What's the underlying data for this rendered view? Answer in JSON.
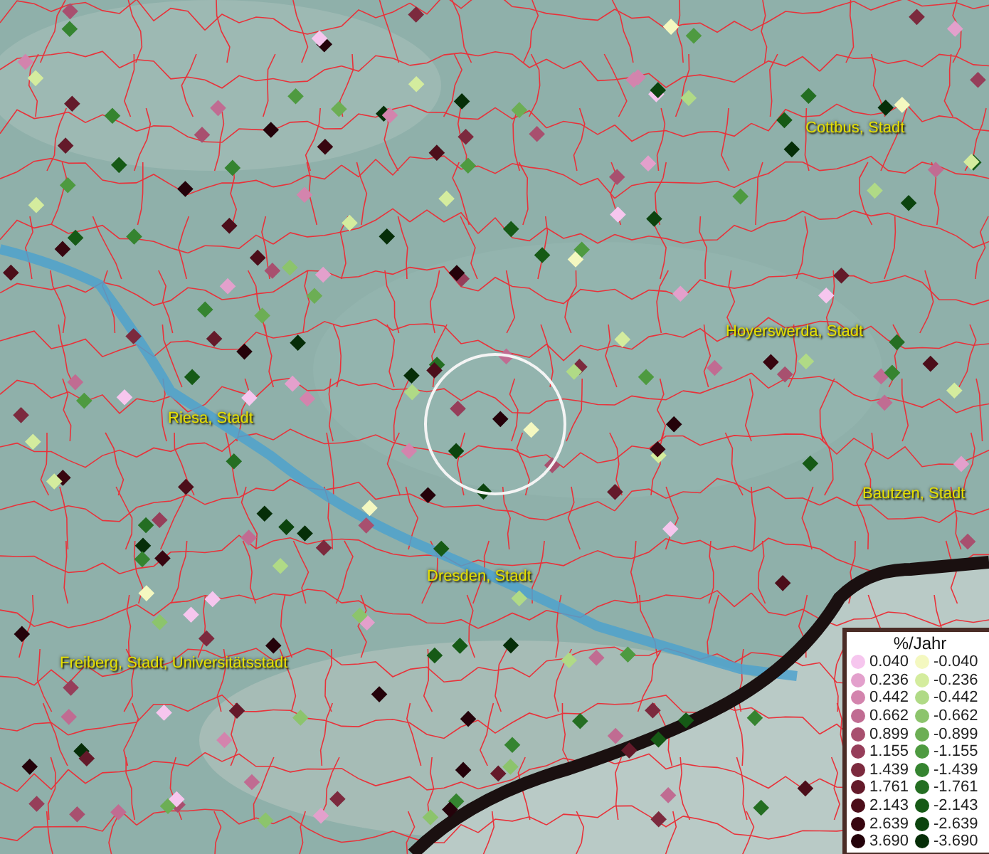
{
  "map": {
    "city_labels": [
      {
        "text": "Cottbus, Stadt"
      },
      {
        "text": "Hoyerswerda, Stadt"
      },
      {
        "text": "Riesa, Stadt"
      },
      {
        "text": "Bautzen, Stadt"
      },
      {
        "text": "Dresden, Stadt"
      },
      {
        "text": "Freiberg, Stadt, Universitätsstadt"
      }
    ]
  },
  "legend": {
    "title": "%/Jahr",
    "positive": [
      {
        "label": "0.040",
        "color": "#f6c6ee"
      },
      {
        "label": "0.236",
        "color": "#e3a0cc"
      },
      {
        "label": "0.442",
        "color": "#d384ad"
      },
      {
        "label": "0.662",
        "color": "#c06c92"
      },
      {
        "label": "0.899",
        "color": "#a8506f"
      },
      {
        "label": "1.155",
        "color": "#963e5a"
      },
      {
        "label": "1.439",
        "color": "#7c2a3e"
      },
      {
        "label": "1.761",
        "color": "#641a2a"
      },
      {
        "label": "2.143",
        "color": "#4c0e1a"
      },
      {
        "label": "2.639",
        "color": "#380610"
      },
      {
        "label": "3.690",
        "color": "#24020a"
      }
    ],
    "negative": [
      {
        "label": "-0.040",
        "color": "#f4f8c0"
      },
      {
        "label": "-0.236",
        "color": "#d4ec9e"
      },
      {
        "label": "-0.442",
        "color": "#b0da86"
      },
      {
        "label": "-0.662",
        "color": "#8cc46c"
      },
      {
        "label": "-0.899",
        "color": "#6cae54"
      },
      {
        "label": "-1.155",
        "color": "#4e9a40"
      },
      {
        "label": "-1.439",
        "color": "#358430"
      },
      {
        "label": "-1.761",
        "color": "#246e22"
      },
      {
        "label": "-2.143",
        "color": "#165a16"
      },
      {
        "label": "-2.639",
        "color": "#0c440e"
      },
      {
        "label": "-3.690",
        "color": "#062e08"
      }
    ]
  }
}
